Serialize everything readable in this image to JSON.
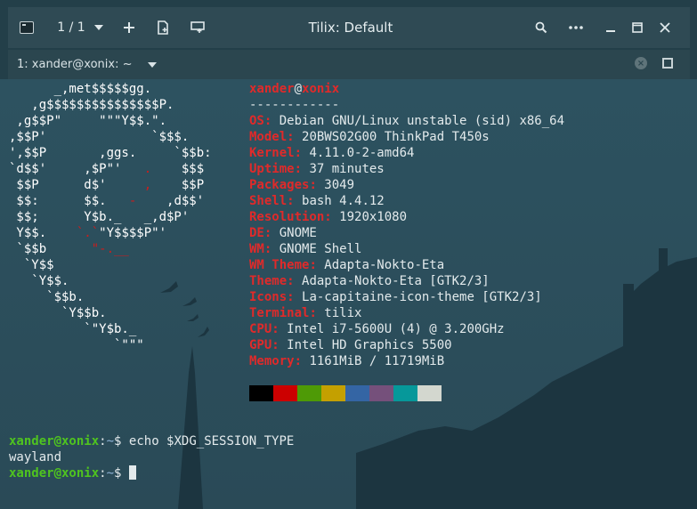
{
  "window": {
    "title": "Tilix: Default",
    "session_switcher": "1 / 1"
  },
  "header_icons": {
    "app": "terminal-app-icon",
    "add": "plus-icon",
    "add_right": "split-right-icon",
    "add_down": "split-down-icon",
    "search": "search-icon",
    "menu": "more-icon",
    "minimize": "minimize-icon",
    "maximize": "maximize-icon",
    "close": "close-icon"
  },
  "tab": {
    "title": "1: xander@xonix: ~"
  },
  "neofetch": {
    "user": "xander",
    "at": "@",
    "host": "xonix",
    "separator": "------------",
    "logo": [
      [
        "      _,met$$$$$gg.",
        ""
      ],
      [
        "   ,g$$$$$$$$$$$$$$$P.",
        ""
      ],
      [
        " ,g$$P\"     \"\"\"Y$$.\".",
        ""
      ],
      [
        ",$$P'              `$$$.",
        ""
      ],
      [
        "',$$P       ,ggs.     `$$b:",
        ""
      ],
      [
        "`d$$'     ,$P\"'   .    $$$",
        ""
      ],
      [
        " $$P      d$'     ,    $$P",
        ""
      ],
      [
        " $$:      $$.   -    ,d$$'",
        ""
      ],
      [
        " $$;      Y$b._   _,d$P'",
        ""
      ],
      [
        " Y$$.    `.`\"Y$$$$P\"'",
        ""
      ],
      [
        " `$$b      \"-.__",
        ""
      ],
      [
        "  `Y$$",
        ""
      ],
      [
        "   `Y$$.",
        ""
      ],
      [
        "     `$$b.",
        ""
      ],
      [
        "       `Y$$b.",
        ""
      ],
      [
        "          `\"Y$b._",
        ""
      ],
      [
        "              `\"\"\"",
        ""
      ]
    ],
    "info": [
      {
        "key": "OS",
        "value": "Debian GNU/Linux unstable (sid) x86_64"
      },
      {
        "key": "Model",
        "value": "20BWS02G00 ThinkPad T450s"
      },
      {
        "key": "Kernel",
        "value": "4.11.0-2-amd64"
      },
      {
        "key": "Uptime",
        "value": "37 minutes"
      },
      {
        "key": "Packages",
        "value": "3049"
      },
      {
        "key": "Shell",
        "value": "bash 4.4.12"
      },
      {
        "key": "Resolution",
        "value": "1920x1080"
      },
      {
        "key": "DE",
        "value": "GNOME"
      },
      {
        "key": "WM",
        "value": "GNOME Shell"
      },
      {
        "key": "WM Theme",
        "value": "Adapta-Nokto-Eta"
      },
      {
        "key": "Theme",
        "value": "Adapta-Nokto-Eta [GTK2/3]"
      },
      {
        "key": "Icons",
        "value": "La-capitaine-icon-theme [GTK2/3]"
      },
      {
        "key": "Terminal",
        "value": "tilix"
      },
      {
        "key": "CPU",
        "value": "Intel i7-5600U (4) @ 3.200GHz"
      },
      {
        "key": "GPU",
        "value": "Intel HD Graphics 5500"
      },
      {
        "key": "Memory",
        "value": "1161MiB / 11719MiB"
      }
    ],
    "palette": [
      "#000000",
      "#cc0000",
      "#4e9a06",
      "#c4a000",
      "#3465a4",
      "#75507b",
      "#06989a",
      "#d3d7cf"
    ]
  },
  "shell": {
    "prompt_user": "xander@xonix",
    "prompt_sep": ":",
    "prompt_path": "~",
    "prompt_symbol": "$",
    "command": "echo $XDG_SESSION_TYPE",
    "output": "wayland"
  },
  "colors": {
    "accent_red": "#e02a2a",
    "prompt_green": "#4fc41f",
    "headerbar": "#2f4a54",
    "terminal_bg": "#2b4d5a"
  }
}
